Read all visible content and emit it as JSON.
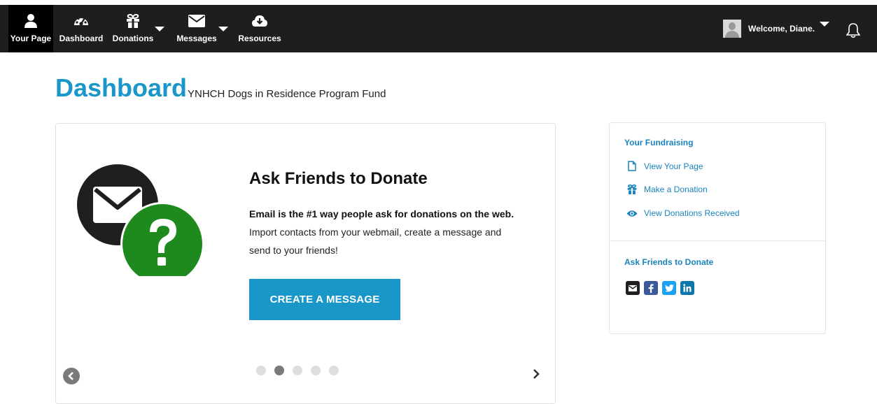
{
  "nav": {
    "items": [
      {
        "label": "Your Page",
        "icon": "user-icon"
      },
      {
        "label": "Dashboard",
        "icon": "dashboard-gauge-icon"
      },
      {
        "label": "Donations",
        "icon": "gift-icon"
      },
      {
        "label": "Messages",
        "icon": "envelope-icon"
      },
      {
        "label": "Resources",
        "icon": "cloud-download-icon"
      }
    ],
    "active": "Your Page",
    "welcome": "Welcome, Diane."
  },
  "header": {
    "title": "Dashboard",
    "subtitle": "YNHCH Dogs in Residence Program Fund"
  },
  "slide": {
    "heading": "Ask Friends to Donate",
    "body_bold": "Email is the #1 way people ask for donations on the web.",
    "body_rest": " Import contacts from your webmail, create a message and send to your friends!",
    "cta": "CREATE A MESSAGE",
    "dot_count": 5,
    "active_dot": 2
  },
  "sidebar": {
    "fundraising_heading": "Your Fundraising",
    "links": [
      {
        "label": "View Your Page",
        "icon": "page-icon"
      },
      {
        "label": "Make a Donation",
        "icon": "gift-icon"
      },
      {
        "label": "View Donations Received",
        "icon": "eye-icon"
      }
    ],
    "ask_heading": "Ask Friends to Donate",
    "share_icons": [
      "email-share-icon",
      "facebook-icon",
      "twitter-icon",
      "linkedin-icon"
    ]
  },
  "colors": {
    "brand_blue": "#1a97c9",
    "link_blue": "#1a83bd",
    "nav_bg": "#1e1e1e",
    "question_green": "#1e8a1e"
  }
}
